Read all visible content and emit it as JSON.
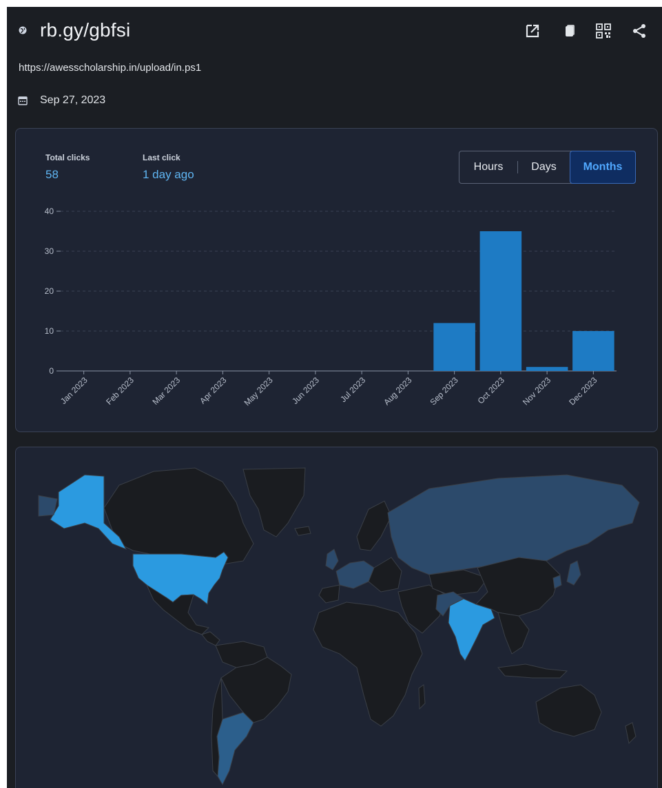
{
  "header": {
    "short_link": "rb.gy/gbfsi",
    "destination_url": "https://awesscholarship.in/upload/in.ps1",
    "created_date": "Sep 27, 2023",
    "icons": [
      "globe-icon",
      "open-external-icon",
      "copy-icon",
      "qr-code-icon",
      "share-icon"
    ]
  },
  "stats": {
    "total_clicks_label": "Total clicks",
    "total_clicks_value": "58",
    "last_click_label": "Last click",
    "last_click_value": "1 day ago"
  },
  "range_toggle": {
    "options": [
      "Hours",
      "Days",
      "Months"
    ],
    "selected": "Months"
  },
  "colors": {
    "background": "#1b1e23",
    "card": "#1e2433",
    "accent": "#2b9ae0",
    "bar": "#1e7bc4",
    "selected_toggle": "#0f2d61",
    "map_highlight": "#2b9ae0",
    "map_medium": "#2c4a6b",
    "map_base": "#1a1c20"
  },
  "chart_data": {
    "type": "bar",
    "categories": [
      "Jan 2023",
      "Feb 2023",
      "Mar 2023",
      "Apr 2023",
      "May 2023",
      "Jun 2023",
      "Jul 2023",
      "Aug 2023",
      "Sep 2023",
      "Oct 2023",
      "Nov 2023",
      "Dec 2023"
    ],
    "values": [
      0,
      0,
      0,
      0,
      0,
      0,
      0,
      0,
      12,
      35,
      1,
      10
    ],
    "yticks": [
      0,
      10,
      20,
      30,
      40
    ],
    "ylim": [
      0,
      40
    ],
    "grid": true,
    "title": "",
    "xlabel": "",
    "ylabel": ""
  },
  "map": {
    "highlighted_countries": [
      "United States",
      "India"
    ],
    "medium_countries": [
      "Russia",
      "Argentina",
      "United Kingdom",
      "France",
      "Germany",
      "Japan"
    ]
  }
}
